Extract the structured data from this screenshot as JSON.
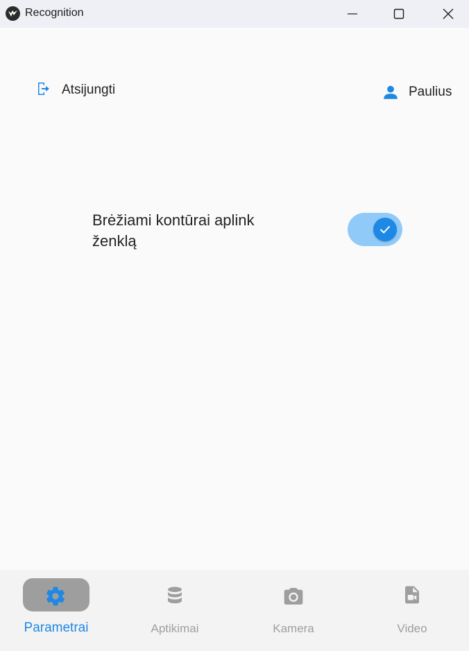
{
  "window": {
    "title": "Recognition"
  },
  "header": {
    "logout_label": "Atsijungti",
    "user_name": "Paulius"
  },
  "settings": {
    "draw_contours_label": "Brėžiami kontūrai aplink ženklą",
    "draw_contours_enabled": true
  },
  "bottom_nav": {
    "items": [
      {
        "label": "Parametrai",
        "icon": "gear-icon",
        "active": true
      },
      {
        "label": "Aptikimai",
        "icon": "database-icon",
        "active": false
      },
      {
        "label": "Kamera",
        "icon": "camera-icon",
        "active": false
      },
      {
        "label": "Video",
        "icon": "video-file-icon",
        "active": false
      }
    ]
  },
  "colors": {
    "accent": "#1e88e5",
    "toggle_track": "#90caf9",
    "inactive": "#9e9e9e",
    "active_pill": "#9e9e9e",
    "titlebar": "#eef0f6",
    "background": "#fafafa"
  }
}
